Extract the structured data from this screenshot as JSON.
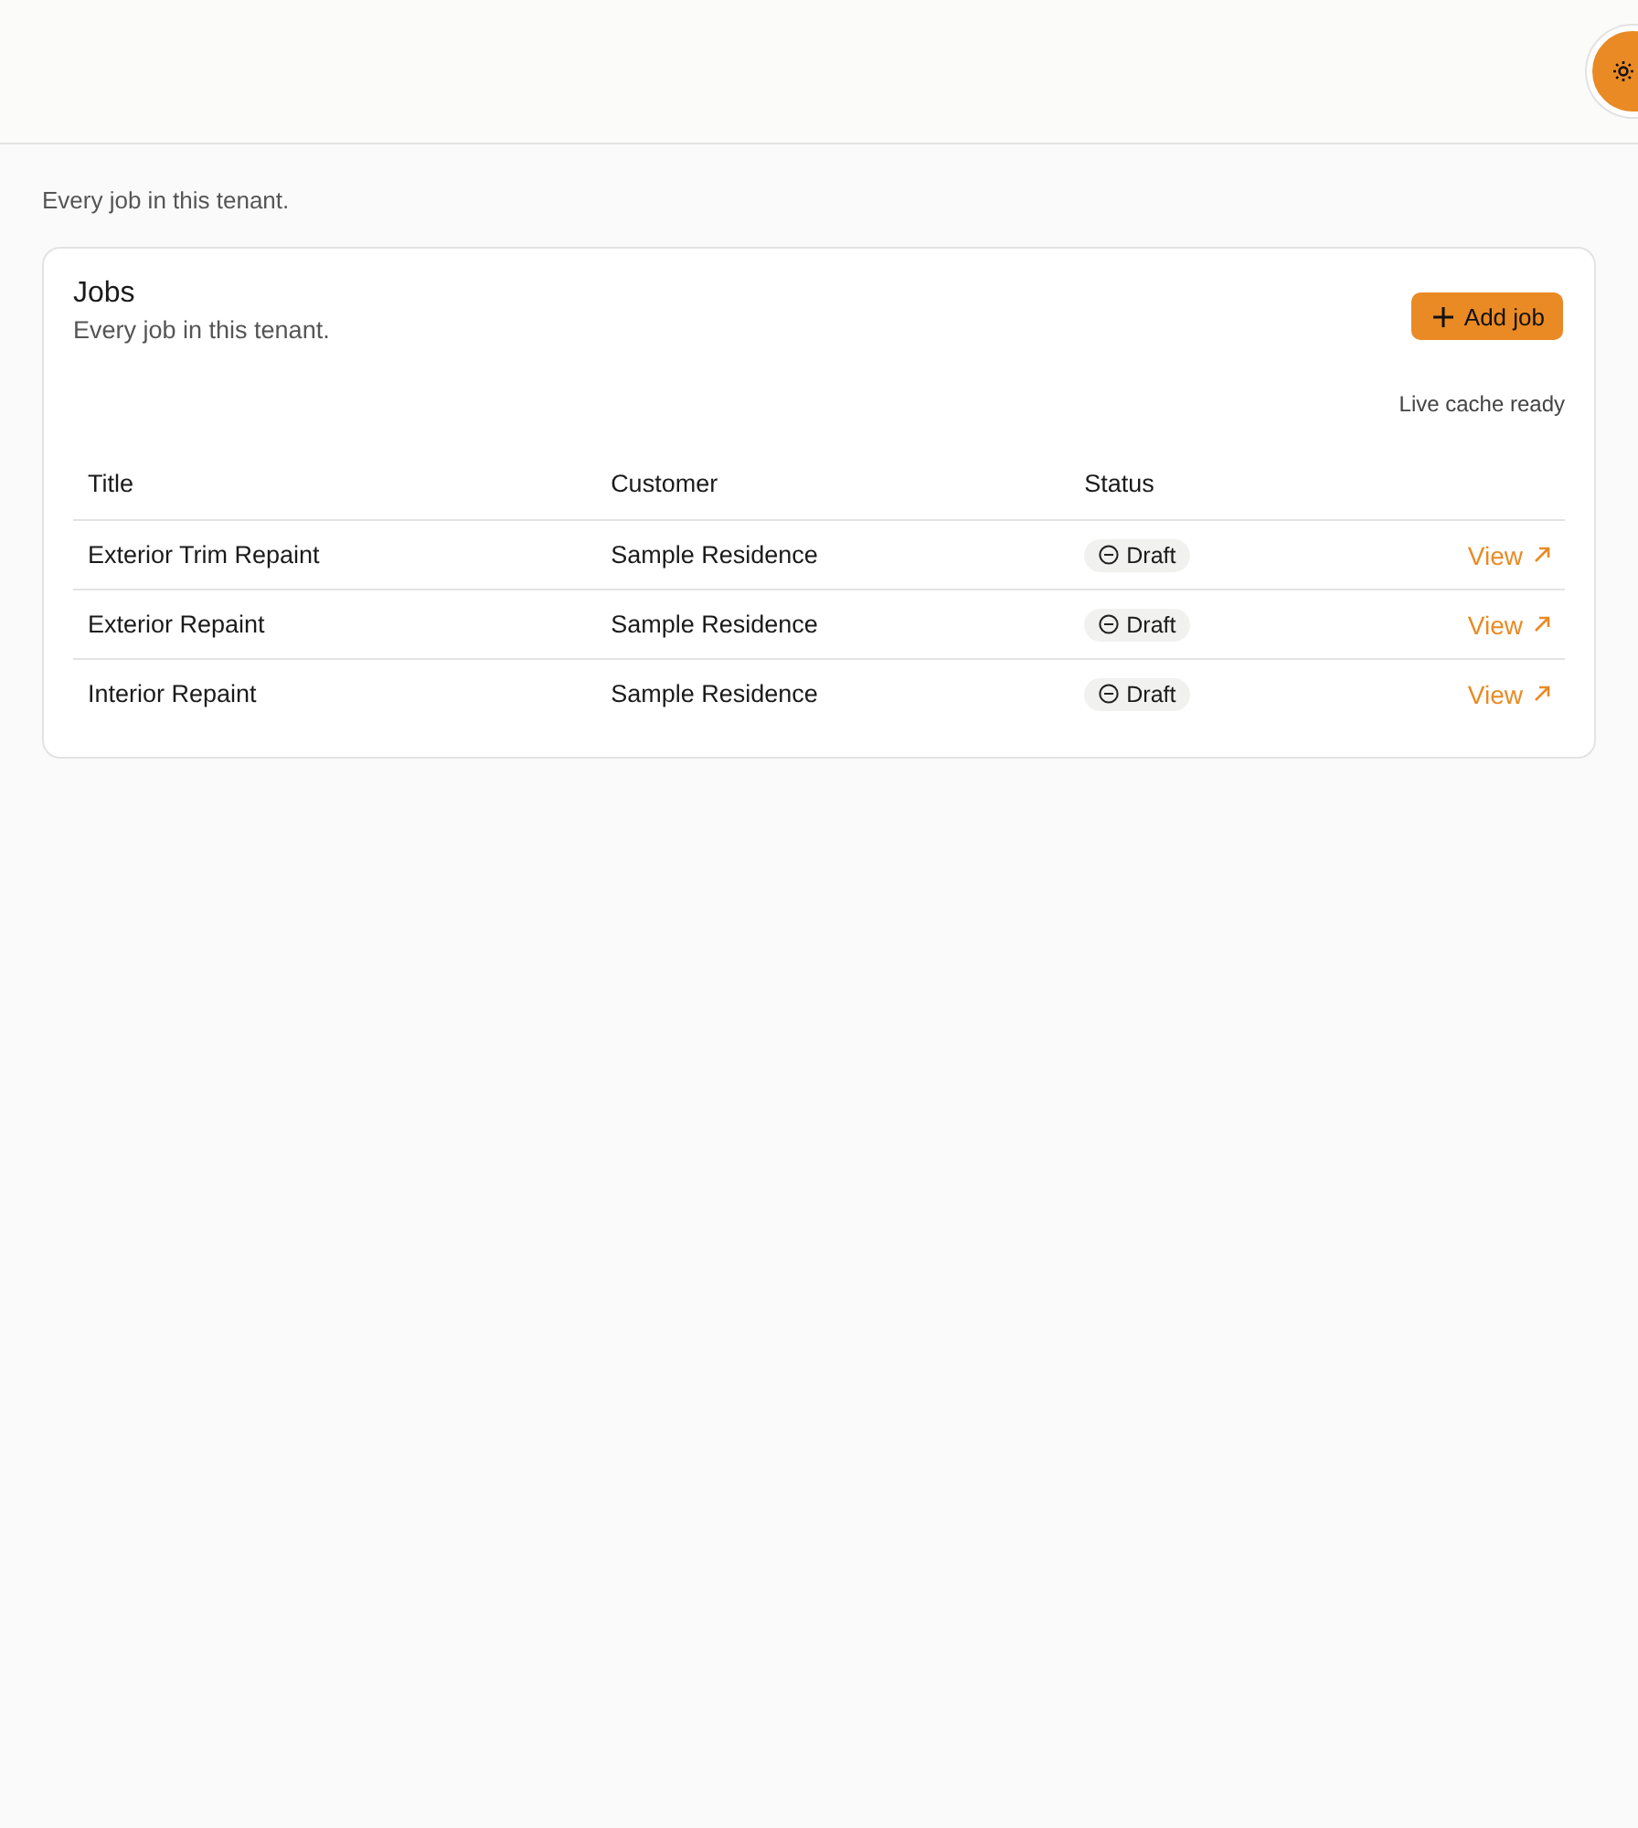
{
  "header": {
    "theme_toggle": {
      "kind": "light"
    }
  },
  "page": {
    "subtitle": "Every job in this tenant."
  },
  "card": {
    "title": "Jobs",
    "subtitle": "Every job in this tenant.",
    "add_button": "Add job",
    "cache_status": "Live cache ready",
    "table": {
      "columns": [
        "Title",
        "Customer",
        "Status"
      ],
      "rows": [
        {
          "title": "Exterior Trim Repaint",
          "customer": "Sample Residence",
          "status": "Draft",
          "link": "View"
        },
        {
          "title": "Exterior Repaint",
          "customer": "Sample Residence",
          "status": "Draft",
          "link": "View"
        },
        {
          "title": "Interior Repaint",
          "customer": "Sample Residence",
          "status": "Draft",
          "link": "View"
        }
      ]
    }
  }
}
